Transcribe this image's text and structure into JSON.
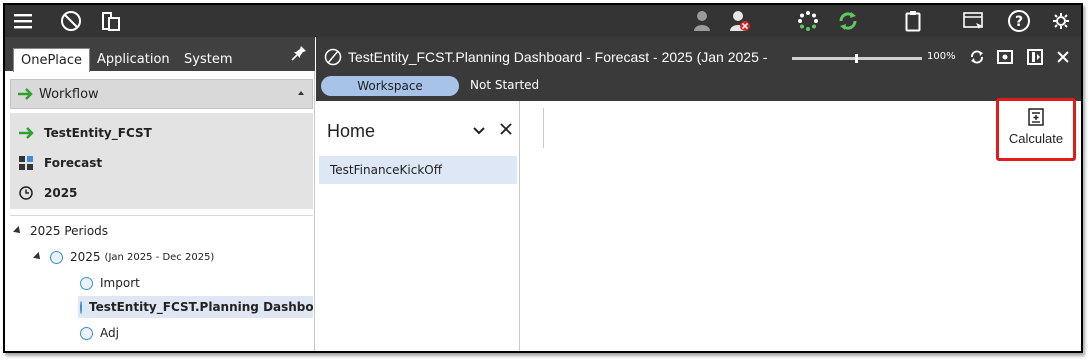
{
  "topbar": {
    "icons": [
      "menu-icon",
      "compass-icon",
      "documents-icon",
      "user-icon",
      "user-remove-icon",
      "loading-icon",
      "refresh-icon",
      "clipboard-icon",
      "form-icon",
      "help-icon",
      "settings-icon"
    ]
  },
  "left": {
    "tabs": [
      {
        "label": "OnePlace",
        "active": true
      },
      {
        "label": "Application",
        "active": false
      },
      {
        "label": "System",
        "active": false
      }
    ],
    "workflow_label": "Workflow",
    "pov": [
      {
        "icon": "arrow-right-icon",
        "label": "TestEntity_FCST"
      },
      {
        "icon": "scenario-icon",
        "label": "Forecast"
      },
      {
        "icon": "clock-icon",
        "label": "2025"
      }
    ],
    "tree": {
      "root": "2025 Periods",
      "year": "2025",
      "year_range": "(Jan 2025 - Dec 2025)",
      "children": [
        "Import",
        "TestEntity_FCST.Planning Dashboard",
        "Adj"
      ]
    }
  },
  "right": {
    "title": "TestEntity_FCST.Planning Dashboard  -  Forecast  -  2025 (Jan 2025 -",
    "workspace_label": "Workspace",
    "status": "Not Started",
    "zoom": "100%",
    "home": {
      "title": "Home",
      "item": "TestFinanceKickOff"
    },
    "calculate_label": "Calculate"
  },
  "colors": {
    "topbar": "#343434",
    "accent_green": "#2ea02e",
    "workspace_pill": "#a7c4e8",
    "highlight_red": "#e01b1b"
  }
}
